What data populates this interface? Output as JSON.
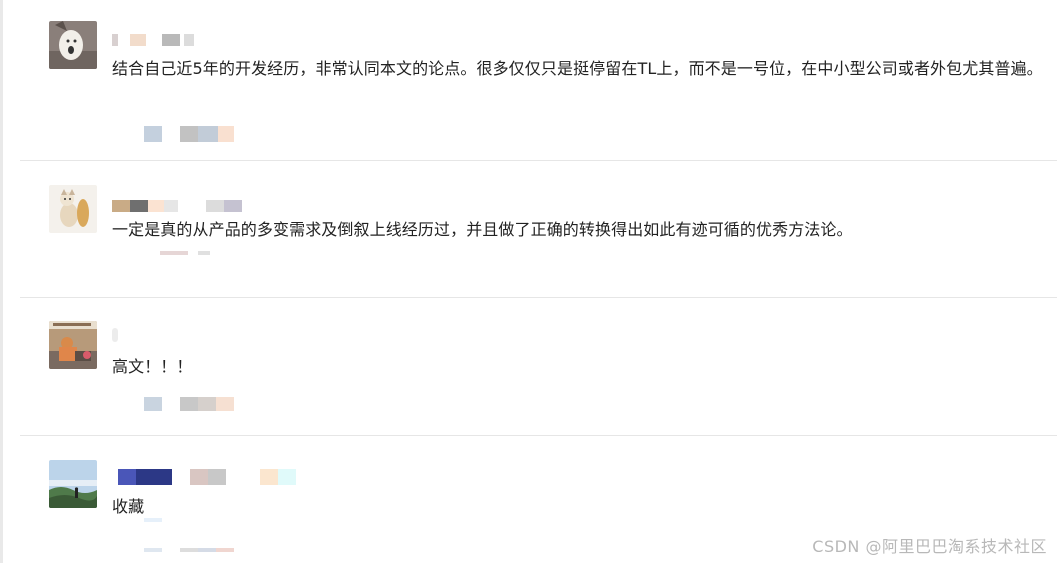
{
  "comments": [
    {
      "text": "结合自己近5年的开发经历，非常认同本文的论点。很多仅仅只是挺停留在TL上，而不是一号位，在中小型公司或者外包尤其普遍。",
      "avatar_icon": "cartoon-face-avatar"
    },
    {
      "text": "一定是真的从产品的多变需求及倒叙上线经历过，并且做了正确的转换得出如此有迹可循的优秀方法论。",
      "avatar_icon": "cat-illustration-avatar"
    },
    {
      "text": "高文！！！",
      "avatar_icon": "photo-avatar"
    },
    {
      "text": "收藏",
      "avatar_icon": "landscape-avatar"
    }
  ],
  "watermark": "CSDN @阿里巴巴淘系技术社区",
  "colors": {
    "text": "#222222",
    "divider": "#e6e6e6",
    "watermark": "#b8b8b8"
  }
}
